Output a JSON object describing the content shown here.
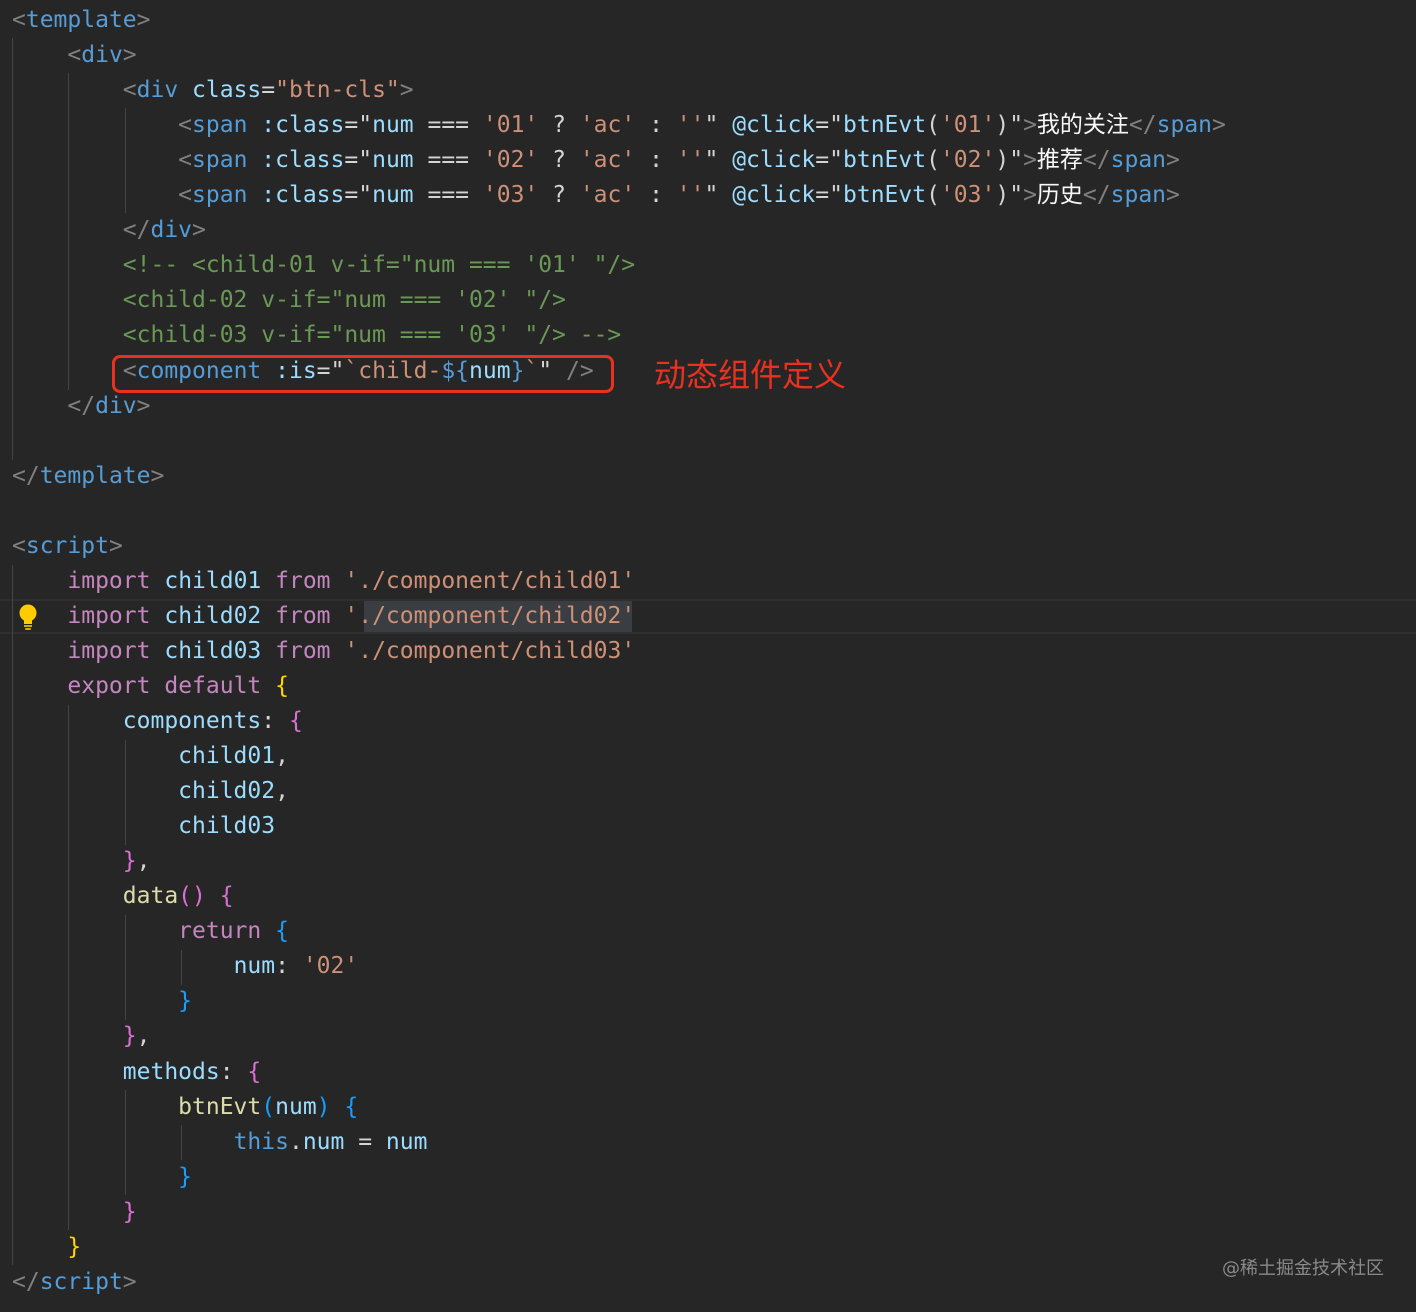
{
  "code_lines": [
    [
      {
        "t": "<",
        "c": 0
      },
      {
        "t": "template",
        "c": 1
      },
      {
        "t": ">",
        "c": 0
      }
    ],
    [
      {
        "t": "    ",
        "c": 4
      },
      {
        "t": "<",
        "c": 0
      },
      {
        "t": "div",
        "c": 1
      },
      {
        "t": ">",
        "c": 0
      }
    ],
    [
      {
        "t": "        ",
        "c": 4
      },
      {
        "t": "<",
        "c": 0
      },
      {
        "t": "div",
        "c": 1
      },
      {
        "t": " ",
        "c": 4
      },
      {
        "t": "class",
        "c": 2
      },
      {
        "t": "=",
        "c": 4
      },
      {
        "t": "\"btn-cls\"",
        "c": 3
      },
      {
        "t": ">",
        "c": 0
      }
    ],
    [
      {
        "t": "            ",
        "c": 4
      },
      {
        "t": "<",
        "c": 0
      },
      {
        "t": "span",
        "c": 1
      },
      {
        "t": " ",
        "c": 4
      },
      {
        "t": ":class",
        "c": 2
      },
      {
        "t": "=",
        "c": 4
      },
      {
        "t": "\"",
        "c": 4
      },
      {
        "t": "num",
        "c": 2
      },
      {
        "t": " === ",
        "c": 4
      },
      {
        "t": "'01'",
        "c": 3
      },
      {
        "t": " ? ",
        "c": 4
      },
      {
        "t": "'ac'",
        "c": 3
      },
      {
        "t": " : ",
        "c": 4
      },
      {
        "t": "''",
        "c": 3
      },
      {
        "t": "\"",
        "c": 4
      },
      {
        "t": " ",
        "c": 4
      },
      {
        "t": "@click",
        "c": 2
      },
      {
        "t": "=",
        "c": 4
      },
      {
        "t": "\"",
        "c": 4
      },
      {
        "t": "btnEvt",
        "c": 2
      },
      {
        "t": "(",
        "c": 4
      },
      {
        "t": "'01'",
        "c": 3
      },
      {
        "t": ")",
        "c": 4
      },
      {
        "t": "\"",
        "c": 4
      },
      {
        "t": ">",
        "c": 0
      },
      {
        "t": "我的关注",
        "c": 11
      },
      {
        "t": "</",
        "c": 0
      },
      {
        "t": "span",
        "c": 1
      },
      {
        "t": ">",
        "c": 0
      }
    ],
    [
      {
        "t": "            ",
        "c": 4
      },
      {
        "t": "<",
        "c": 0
      },
      {
        "t": "span",
        "c": 1
      },
      {
        "t": " ",
        "c": 4
      },
      {
        "t": ":class",
        "c": 2
      },
      {
        "t": "=",
        "c": 4
      },
      {
        "t": "\"",
        "c": 4
      },
      {
        "t": "num",
        "c": 2
      },
      {
        "t": " === ",
        "c": 4
      },
      {
        "t": "'02'",
        "c": 3
      },
      {
        "t": " ? ",
        "c": 4
      },
      {
        "t": "'ac'",
        "c": 3
      },
      {
        "t": " : ",
        "c": 4
      },
      {
        "t": "''",
        "c": 3
      },
      {
        "t": "\"",
        "c": 4
      },
      {
        "t": " ",
        "c": 4
      },
      {
        "t": "@click",
        "c": 2
      },
      {
        "t": "=",
        "c": 4
      },
      {
        "t": "\"",
        "c": 4
      },
      {
        "t": "btnEvt",
        "c": 2
      },
      {
        "t": "(",
        "c": 4
      },
      {
        "t": "'02'",
        "c": 3
      },
      {
        "t": ")",
        "c": 4
      },
      {
        "t": "\"",
        "c": 4
      },
      {
        "t": ">",
        "c": 0
      },
      {
        "t": "推荐",
        "c": 11
      },
      {
        "t": "</",
        "c": 0
      },
      {
        "t": "span",
        "c": 1
      },
      {
        "t": ">",
        "c": 0
      }
    ],
    [
      {
        "t": "            ",
        "c": 4
      },
      {
        "t": "<",
        "c": 0
      },
      {
        "t": "span",
        "c": 1
      },
      {
        "t": " ",
        "c": 4
      },
      {
        "t": ":class",
        "c": 2
      },
      {
        "t": "=",
        "c": 4
      },
      {
        "t": "\"",
        "c": 4
      },
      {
        "t": "num",
        "c": 2
      },
      {
        "t": " === ",
        "c": 4
      },
      {
        "t": "'03'",
        "c": 3
      },
      {
        "t": " ? ",
        "c": 4
      },
      {
        "t": "'ac'",
        "c": 3
      },
      {
        "t": " : ",
        "c": 4
      },
      {
        "t": "''",
        "c": 3
      },
      {
        "t": "\"",
        "c": 4
      },
      {
        "t": " ",
        "c": 4
      },
      {
        "t": "@click",
        "c": 2
      },
      {
        "t": "=",
        "c": 4
      },
      {
        "t": "\"",
        "c": 4
      },
      {
        "t": "btnEvt",
        "c": 2
      },
      {
        "t": "(",
        "c": 4
      },
      {
        "t": "'03'",
        "c": 3
      },
      {
        "t": ")",
        "c": 4
      },
      {
        "t": "\"",
        "c": 4
      },
      {
        "t": ">",
        "c": 0
      },
      {
        "t": "历史",
        "c": 11
      },
      {
        "t": "</",
        "c": 0
      },
      {
        "t": "span",
        "c": 1
      },
      {
        "t": ">",
        "c": 0
      }
    ],
    [
      {
        "t": "        ",
        "c": 4
      },
      {
        "t": "</",
        "c": 0
      },
      {
        "t": "div",
        "c": 1
      },
      {
        "t": ">",
        "c": 0
      }
    ],
    [
      {
        "t": "        ",
        "c": 4
      },
      {
        "t": "<!-- <child-01 v-if=\"num === '01' \"/>",
        "c": 5
      }
    ],
    [
      {
        "t": "        ",
        "c": 4
      },
      {
        "t": "<child-02 v-if=\"num === '02' \"/>",
        "c": 5
      }
    ],
    [
      {
        "t": "        ",
        "c": 4
      },
      {
        "t": "<child-03 v-if=\"num === '03' \"/> -->",
        "c": 5
      }
    ],
    [
      {
        "t": "        ",
        "c": 4
      },
      {
        "t": "<",
        "c": 0
      },
      {
        "t": "component",
        "c": 1
      },
      {
        "t": " ",
        "c": 4
      },
      {
        "t": ":is",
        "c": 2
      },
      {
        "t": "=",
        "c": 4
      },
      {
        "t": "\"",
        "c": 4
      },
      {
        "t": "`child-",
        "c": 3
      },
      {
        "t": "${",
        "c": 1
      },
      {
        "t": "num",
        "c": 2
      },
      {
        "t": "}",
        "c": 1
      },
      {
        "t": "`",
        "c": 3
      },
      {
        "t": "\"",
        "c": 4
      },
      {
        "t": " />",
        "c": 0
      }
    ],
    [
      {
        "t": "    ",
        "c": 4
      },
      {
        "t": "</",
        "c": 0
      },
      {
        "t": "div",
        "c": 1
      },
      {
        "t": ">",
        "c": 0
      }
    ],
    [
      {
        "t": "",
        "c": 4
      }
    ],
    [
      {
        "t": "</",
        "c": 0
      },
      {
        "t": "template",
        "c": 1
      },
      {
        "t": ">",
        "c": 0
      }
    ],
    [
      {
        "t": "",
        "c": 4
      }
    ],
    [
      {
        "t": "<",
        "c": 0
      },
      {
        "t": "script",
        "c": 1
      },
      {
        "t": ">",
        "c": 0
      }
    ],
    [
      {
        "t": "    ",
        "c": 4
      },
      {
        "t": "import",
        "c": 6
      },
      {
        "t": " ",
        "c": 4
      },
      {
        "t": "child01",
        "c": 2
      },
      {
        "t": " ",
        "c": 4
      },
      {
        "t": "from",
        "c": 6
      },
      {
        "t": " ",
        "c": 4
      },
      {
        "t": "'./component/child01'",
        "c": 3
      }
    ],
    [
      {
        "t": "    ",
        "c": 4
      },
      {
        "t": "import",
        "c": 6
      },
      {
        "t": " ",
        "c": 4
      },
      {
        "t": "child02",
        "c": 2
      },
      {
        "t": " ",
        "c": 4
      },
      {
        "t": "from",
        "c": 6
      },
      {
        "t": " ",
        "c": 4
      },
      {
        "t": "'./component/child02'",
        "c": 3
      }
    ],
    [
      {
        "t": "    ",
        "c": 4
      },
      {
        "t": "import",
        "c": 6
      },
      {
        "t": " ",
        "c": 4
      },
      {
        "t": "child03",
        "c": 2
      },
      {
        "t": " ",
        "c": 4
      },
      {
        "t": "from",
        "c": 6
      },
      {
        "t": " ",
        "c": 4
      },
      {
        "t": "'./component/child03'",
        "c": 3
      }
    ],
    [
      {
        "t": "    ",
        "c": 4
      },
      {
        "t": "export",
        "c": 6
      },
      {
        "t": " ",
        "c": 4
      },
      {
        "t": "default",
        "c": 6
      },
      {
        "t": " ",
        "c": 4
      },
      {
        "t": "{",
        "c": 8
      }
    ],
    [
      {
        "t": "        ",
        "c": 4
      },
      {
        "t": "components",
        "c": 2
      },
      {
        "t": ": ",
        "c": 4
      },
      {
        "t": "{",
        "c": 9
      }
    ],
    [
      {
        "t": "            ",
        "c": 4
      },
      {
        "t": "child01",
        "c": 2
      },
      {
        "t": ",",
        "c": 4
      }
    ],
    [
      {
        "t": "            ",
        "c": 4
      },
      {
        "t": "child02",
        "c": 2
      },
      {
        "t": ",",
        "c": 4
      }
    ],
    [
      {
        "t": "            ",
        "c": 4
      },
      {
        "t": "child03",
        "c": 2
      }
    ],
    [
      {
        "t": "        ",
        "c": 4
      },
      {
        "t": "}",
        "c": 9
      },
      {
        "t": ",",
        "c": 4
      }
    ],
    [
      {
        "t": "        ",
        "c": 4
      },
      {
        "t": "data",
        "c": 7
      },
      {
        "t": "()",
        "c": 9
      },
      {
        "t": " ",
        "c": 4
      },
      {
        "t": "{",
        "c": 9
      }
    ],
    [
      {
        "t": "            ",
        "c": 4
      },
      {
        "t": "return",
        "c": 6
      },
      {
        "t": " ",
        "c": 4
      },
      {
        "t": "{",
        "c": 10
      }
    ],
    [
      {
        "t": "                ",
        "c": 4
      },
      {
        "t": "num",
        "c": 2
      },
      {
        "t": ": ",
        "c": 4
      },
      {
        "t": "'02'",
        "c": 3
      }
    ],
    [
      {
        "t": "            ",
        "c": 4
      },
      {
        "t": "}",
        "c": 10
      }
    ],
    [
      {
        "t": "        ",
        "c": 4
      },
      {
        "t": "}",
        "c": 9
      },
      {
        "t": ",",
        "c": 4
      }
    ],
    [
      {
        "t": "        ",
        "c": 4
      },
      {
        "t": "methods",
        "c": 2
      },
      {
        "t": ": ",
        "c": 4
      },
      {
        "t": "{",
        "c": 9
      }
    ],
    [
      {
        "t": "            ",
        "c": 4
      },
      {
        "t": "btnEvt",
        "c": 7
      },
      {
        "t": "(",
        "c": 10
      },
      {
        "t": "num",
        "c": 2
      },
      {
        "t": ")",
        "c": 10
      },
      {
        "t": " ",
        "c": 4
      },
      {
        "t": "{",
        "c": 10
      }
    ],
    [
      {
        "t": "                ",
        "c": 4
      },
      {
        "t": "this",
        "c": 1
      },
      {
        "t": ".",
        "c": 4
      },
      {
        "t": "num",
        "c": 2
      },
      {
        "t": " = ",
        "c": 4
      },
      {
        "t": "num",
        "c": 2
      }
    ],
    [
      {
        "t": "            ",
        "c": 4
      },
      {
        "t": "}",
        "c": 10
      }
    ],
    [
      {
        "t": "        ",
        "c": 4
      },
      {
        "t": "}",
        "c": 9
      }
    ],
    [
      {
        "t": "    ",
        "c": 4
      },
      {
        "t": "}",
        "c": 8
      }
    ],
    [
      {
        "t": "</",
        "c": 0
      },
      {
        "t": "script",
        "c": 1
      },
      {
        "t": ">",
        "c": 0
      }
    ]
  ],
  "colors": {
    "background": "#262626",
    "bracket": "#808080",
    "tag": "#569cd6",
    "attribute": "#9cdcfe",
    "string": "#ce9178",
    "plain": "#d4d4d4",
    "comment": "#6a9955",
    "keyword": "#c586c0",
    "function": "#dcdcaa",
    "brace_level1": "#ffd700",
    "brace_level2": "#da70d6",
    "brace_level3": "#179fff",
    "annotation": "#e8321f"
  },
  "annotation_text": "动态组件定义",
  "watermark": "@稀土掘金技术社区",
  "icons": {
    "lightbulb": "lightbulb-icon"
  }
}
